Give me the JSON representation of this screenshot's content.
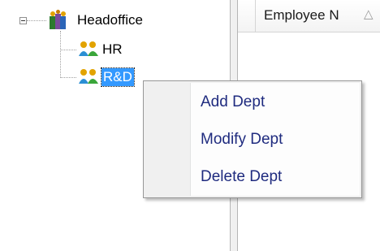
{
  "tree": {
    "root": {
      "label": "Headoffice",
      "icon": "building-people-icon",
      "expanded": true
    },
    "children": [
      {
        "label": "HR",
        "icon": "people-icon",
        "selected": false
      },
      {
        "label": "R&D",
        "icon": "people-icon",
        "selected": true
      }
    ]
  },
  "grid": {
    "column_header": "Employee N",
    "sort_icon": "sort-ascending-triangle-icon"
  },
  "context_menu": {
    "items": [
      "Add Dept",
      "Modify Dept",
      "Delete Dept"
    ]
  },
  "colors": {
    "selection": "#3399ff",
    "menu_text": "#1f2b7f"
  }
}
